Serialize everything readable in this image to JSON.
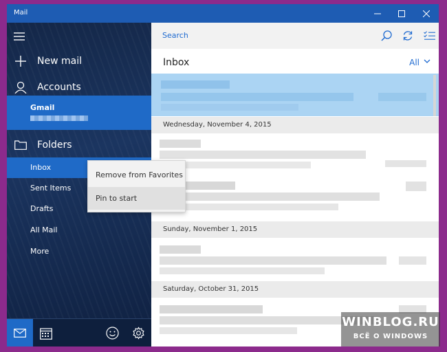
{
  "window": {
    "title": "Mail"
  },
  "sidebar": {
    "new_mail": "New mail",
    "accounts": "Accounts",
    "account_name": "Gmail",
    "folders": "Folders",
    "folder_items": [
      "Inbox",
      "Sent Items",
      "Drafts",
      "All Mail",
      "More"
    ]
  },
  "search": {
    "placeholder": "Search"
  },
  "inbox": {
    "title": "Inbox",
    "filter": "All",
    "dates": [
      "Wednesday, November 4, 2015",
      "Sunday, November 1, 2015",
      "Saturday, October 31, 2015"
    ]
  },
  "context_menu": {
    "items": [
      "Remove from Favorites",
      "Pin to start"
    ]
  },
  "watermark": {
    "line1": "WINBLOG.RU",
    "line2": "ВСЁ О WINDOWS"
  },
  "colors": {
    "accent": "#1f6ac7",
    "titlebar": "#1e5cb3",
    "selected": "#abd4f3"
  }
}
